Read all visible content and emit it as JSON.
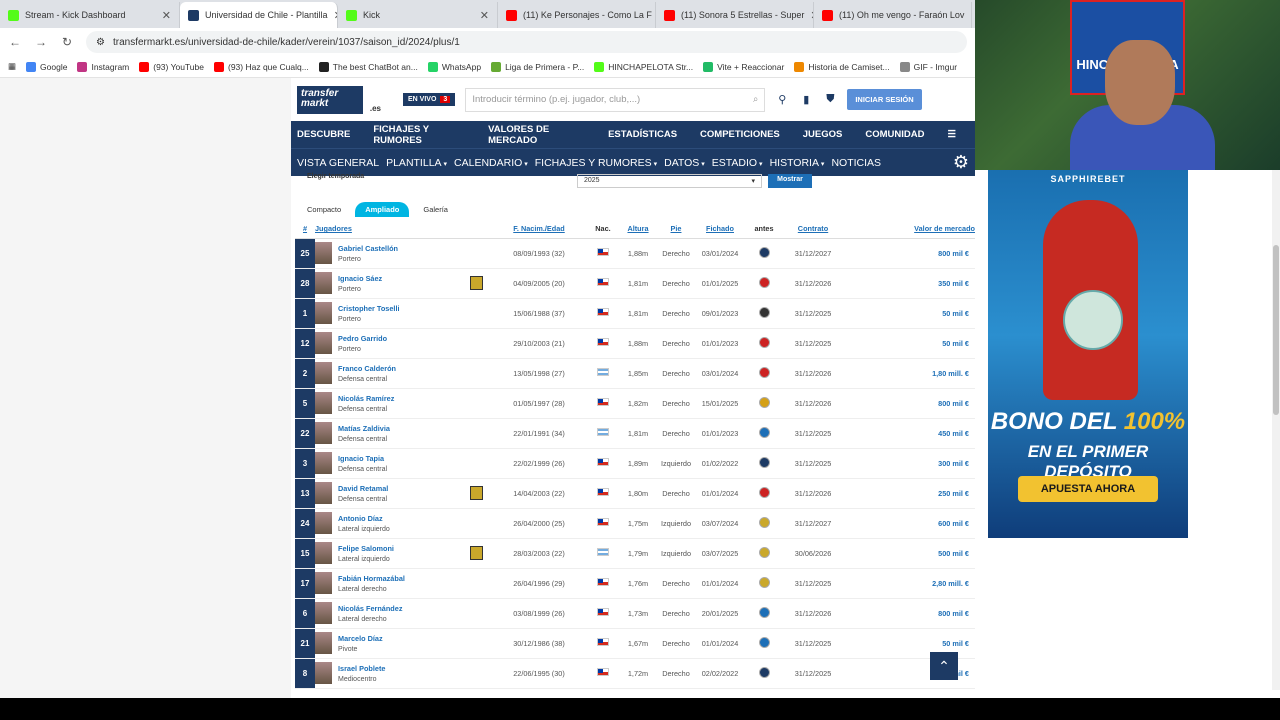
{
  "browser": {
    "tabs": [
      {
        "title": "Stream - Kick Dashboard",
        "color": "#53fc18"
      },
      {
        "title": "Universidad de Chile - Plantilla",
        "color": "#1d3a64",
        "active": true
      },
      {
        "title": "Kick",
        "color": "#53fc18"
      },
      {
        "title": "(11) Ke Personajes - Como La F",
        "color": "#ff0000"
      },
      {
        "title": "(11) Sonora 5 Estrellas - Super",
        "color": "#ff0000"
      },
      {
        "title": "(11) Oh me vengo - Faraón Lov",
        "color": "#ff0000"
      }
    ],
    "url": "transfermarkt.es/universidad-de-chile/kader/verein/1037/saison_id/2024/plus/1",
    "bookmarks": [
      "Google",
      "Instagram",
      "(93) YouTube",
      "(93) Haz que Cualq...",
      "The best ChatBot an...",
      "WhatsApp",
      "Liga de Primera - P...",
      "HINCHAPELOTA Str...",
      "Vite + Reaccionar",
      "Historia de Camiset...",
      "GIF - Imgur"
    ]
  },
  "site": {
    "logo_line1": "transfer",
    "logo_line2": "markt",
    "logo_domain": ".es",
    "live_label": "EN VIVO",
    "live_count": "3",
    "search_placeholder": "Introducir término (p.ej. jugador, club,...)",
    "login_label": "INICIAR SESIÓN",
    "nav_main": [
      "DESCUBRE",
      "FICHAJES Y RUMORES",
      "VALORES DE MERCADO",
      "ESTADÍSTICAS",
      "COMPETICIONES",
      "JUEGOS",
      "COMUNIDAD"
    ],
    "nav_club": [
      "VISTA GENERAL",
      "PLANTILLA",
      "CALENDARIO",
      "FICHAJES Y RUMORES",
      "DATOS",
      "ESTADIO",
      "HISTORIA",
      "NOTICIAS"
    ],
    "season_label": "Elegir temporada",
    "season_value": "2025",
    "show_button": "Mostrar",
    "view_tabs": [
      "Compacto",
      "Ampliado",
      "Galería"
    ]
  },
  "table": {
    "headers": [
      "#",
      "Jugadores",
      "F. Nacim./Edad",
      "Nac.",
      "Altura",
      "Pie",
      "Fichado",
      "antes",
      "Contrato",
      "Valor de mercado"
    ],
    "rows": [
      {
        "num": "25",
        "name": "Gabriel Castellón",
        "pos": "Portero",
        "birth": "08/09/1993 (32)",
        "nat": "cl",
        "height": "1,88m",
        "foot": "Derecho",
        "joined": "03/01/2024",
        "contract": "31/12/2027",
        "value": "800 mil €"
      },
      {
        "num": "28",
        "name": "Ignacio Sáez",
        "pos": "Portero",
        "birth": "04/09/2005 (20)",
        "nat": "cl",
        "height": "1,81m",
        "foot": "Derecho",
        "joined": "01/01/2025",
        "contract": "31/12/2026",
        "value": "350 mil €"
      },
      {
        "num": "1",
        "name": "Cristopher Toselli",
        "pos": "Portero",
        "birth": "15/06/1988 (37)",
        "nat": "cl",
        "height": "1,81m",
        "foot": "Derecho",
        "joined": "09/01/2023",
        "contract": "31/12/2025",
        "value": "50 mil €"
      },
      {
        "num": "12",
        "name": "Pedro Garrido",
        "pos": "Portero",
        "birth": "29/10/2003 (21)",
        "nat": "cl",
        "height": "1,88m",
        "foot": "Derecho",
        "joined": "01/01/2023",
        "contract": "31/12/2025",
        "value": "50 mil €"
      },
      {
        "num": "2",
        "name": "Franco Calderón",
        "pos": "Defensa central",
        "birth": "13/05/1998 (27)",
        "nat": "ar",
        "height": "1,85m",
        "foot": "Derecho",
        "joined": "03/01/2024",
        "contract": "31/12/2026",
        "value": "1,80 mill. €"
      },
      {
        "num": "5",
        "name": "Nicolás Ramírez",
        "pos": "Defensa central",
        "birth": "01/05/1997 (28)",
        "nat": "cl",
        "height": "1,82m",
        "foot": "Derecho",
        "joined": "15/01/2025",
        "contract": "31/12/2026",
        "value": "800 mil €"
      },
      {
        "num": "22",
        "name": "Matías Zaldivia",
        "pos": "Defensa central",
        "birth": "22/01/1991 (34)",
        "nat": "ar",
        "height": "1,81m",
        "foot": "Derecho",
        "joined": "01/01/2023",
        "contract": "31/12/2025",
        "value": "450 mil €"
      },
      {
        "num": "3",
        "name": "Ignacio Tapia",
        "pos": "Defensa central",
        "birth": "22/02/1999 (26)",
        "nat": "cl",
        "height": "1,89m",
        "foot": "Izquierdo",
        "joined": "01/02/2022",
        "contract": "31/12/2025",
        "value": "300 mil €"
      },
      {
        "num": "13",
        "name": "David Retamal",
        "pos": "Defensa central",
        "birth": "14/04/2003 (22)",
        "nat": "cl",
        "height": "1,80m",
        "foot": "Derecho",
        "joined": "01/01/2024",
        "contract": "31/12/2026",
        "value": "250 mil €"
      },
      {
        "num": "24",
        "name": "Antonio Díaz",
        "pos": "Lateral izquierdo",
        "birth": "26/04/2000 (25)",
        "nat": "cl",
        "height": "1,75m",
        "foot": "Izquierdo",
        "joined": "03/07/2024",
        "contract": "31/12/2027",
        "value": "600 mil €"
      },
      {
        "num": "15",
        "name": "Felipe Salomoni",
        "pos": "Lateral izquierdo",
        "birth": "28/03/2003 (22)",
        "nat": "ar",
        "height": "1,79m",
        "foot": "Izquierdo",
        "joined": "03/07/2025",
        "contract": "30/06/2026",
        "value": "500 mil €"
      },
      {
        "num": "17",
        "name": "Fabián Hormazábal",
        "pos": "Lateral derecho",
        "birth": "26/04/1996 (29)",
        "nat": "cl",
        "height": "1,76m",
        "foot": "Derecho",
        "joined": "01/01/2024",
        "contract": "31/12/2025",
        "value": "2,80 mill. €"
      },
      {
        "num": "6",
        "name": "Nicolás Fernández",
        "pos": "Lateral derecho",
        "birth": "03/08/1999 (26)",
        "nat": "cl",
        "height": "1,73m",
        "foot": "Derecho",
        "joined": "20/01/2025",
        "contract": "31/12/2026",
        "value": "800 mil €"
      },
      {
        "num": "21",
        "name": "Marcelo Díaz",
        "pos": "Pivote",
        "birth": "30/12/1986 (38)",
        "nat": "cl",
        "height": "1,67m",
        "foot": "Derecho",
        "joined": "01/01/2024",
        "contract": "31/12/2025",
        "value": "50 mil €"
      },
      {
        "num": "8",
        "name": "Israel Poblete",
        "pos": "Mediocentro",
        "birth": "22/06/1995 (30)",
        "nat": "cl",
        "height": "1,72m",
        "foot": "Derecho",
        "joined": "02/02/2022",
        "contract": "31/12/2025",
        "value": "mil €"
      }
    ]
  },
  "ad": {
    "brand": "SAPPHIREBET",
    "headline1a": "BONO DEL",
    "headline1b": "100%",
    "headline2": "EN EL PRIMER DEPÓSITO",
    "cta": "APUESTA AHORA"
  },
  "webcam": {
    "banner_text": "HINCHAPELOTA"
  }
}
